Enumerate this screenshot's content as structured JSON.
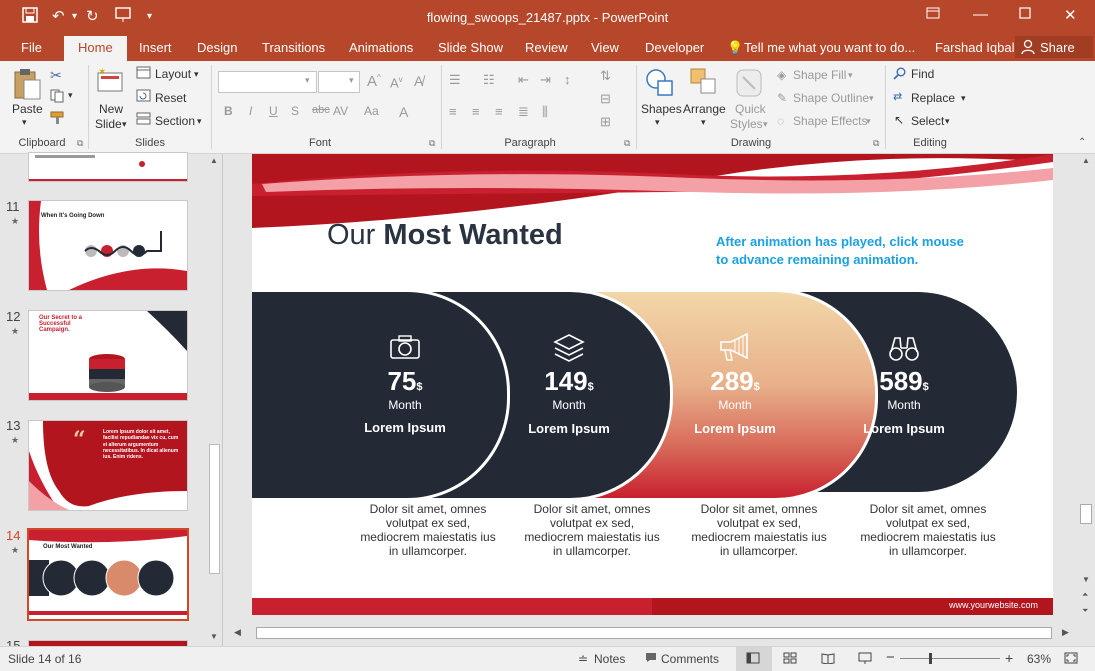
{
  "window": {
    "title": "flowing_swoops_21487.pptx - PowerPoint",
    "user": "Farshad Iqbal",
    "share": "Share"
  },
  "tabs": [
    "File",
    "Home",
    "Insert",
    "Design",
    "Transitions",
    "Animations",
    "Slide Show",
    "Review",
    "View",
    "Developer"
  ],
  "active_tab": "Home",
  "tell_me": "Tell me what you want to do...",
  "ribbon": {
    "clipboard": {
      "paste": "Paste",
      "label": "Clipboard"
    },
    "slides": {
      "new_slide_1": "New",
      "new_slide_2": "Slide",
      "layout": "Layout",
      "reset": "Reset",
      "section": "Section",
      "label": "Slides"
    },
    "font": {
      "label": "Font",
      "bold": "B",
      "italic": "I",
      "underline": "U",
      "shadow": "S",
      "strike": "abc",
      "spacing": "AV",
      "case": "Aa"
    },
    "paragraph": {
      "label": "Paragraph"
    },
    "drawing": {
      "shapes": "Shapes",
      "arrange": "Arrange",
      "quick_styles_1": "Quick",
      "quick_styles_2": "Styles",
      "shape_fill": "Shape Fill",
      "shape_outline": "Shape Outline",
      "shape_effects": "Shape Effects",
      "label": "Drawing"
    },
    "editing": {
      "find": "Find",
      "replace": "Replace",
      "select": "Select",
      "label": "Editing"
    }
  },
  "thumbnails": [
    {
      "num": "11",
      "title": "When It's Going Down"
    },
    {
      "num": "12",
      "title": "Our Secret to a Successful Campaign."
    },
    {
      "num": "13",
      "title": "Lorem ipsum dolor sit amet, facilisi repudiandae vix cu, cum ei alterum argumentum necessitatibus. In dicat alienum ius. Enim ridens."
    },
    {
      "num": "14",
      "title": "Our Most Wanted"
    },
    {
      "num": "15",
      "title": ""
    }
  ],
  "slide": {
    "title_light": "Our ",
    "title_bold": "Most Wanted",
    "note_line1": "After animation has played, click mouse",
    "note_line2": "to advance remaining animation.",
    "website": "www.yourwebsite.com",
    "stats": [
      {
        "icon": "camera-icon",
        "value": "75",
        "unit": "$",
        "period": "Month",
        "label": "Lorem Ipsum",
        "desc": [
          "Dolor sit amet, omnes",
          "volutpat ex sed,",
          "mediocrem maiestatis ius",
          "in ullamcorper."
        ]
      },
      {
        "icon": "layers-icon",
        "value": "149",
        "unit": "$",
        "period": "Month",
        "label": "Lorem Ipsum",
        "desc": [
          "Dolor sit amet, omnes",
          "volutpat ex sed,",
          "mediocrem maiestatis ius",
          "in ullamcorper."
        ]
      },
      {
        "icon": "megaphone-icon",
        "value": "289",
        "unit": "$",
        "period": "Month",
        "label": "Lorem Ipsum",
        "desc": [
          "Dolor sit amet, omnes",
          "volutpat ex sed,",
          "mediocrem maiestatis ius",
          "in ullamcorper."
        ]
      },
      {
        "icon": "binoculars-icon",
        "value": "589",
        "unit": "$",
        "period": "Month",
        "label": "Lorem Ipsum",
        "desc": [
          "Dolor sit amet, omnes",
          "volutpat ex sed,",
          "mediocrem maiestatis ius",
          "in ullamcorper."
        ]
      }
    ]
  },
  "status": {
    "slide_of": "Slide 14 of 16",
    "notes": "Notes",
    "comments": "Comments",
    "zoom": "63%"
  },
  "colors": {
    "accent": "#b7472a",
    "dark": "#232a36",
    "red": "#c8202e",
    "gold": "#e8c99a",
    "note": "#1ba1e2"
  }
}
